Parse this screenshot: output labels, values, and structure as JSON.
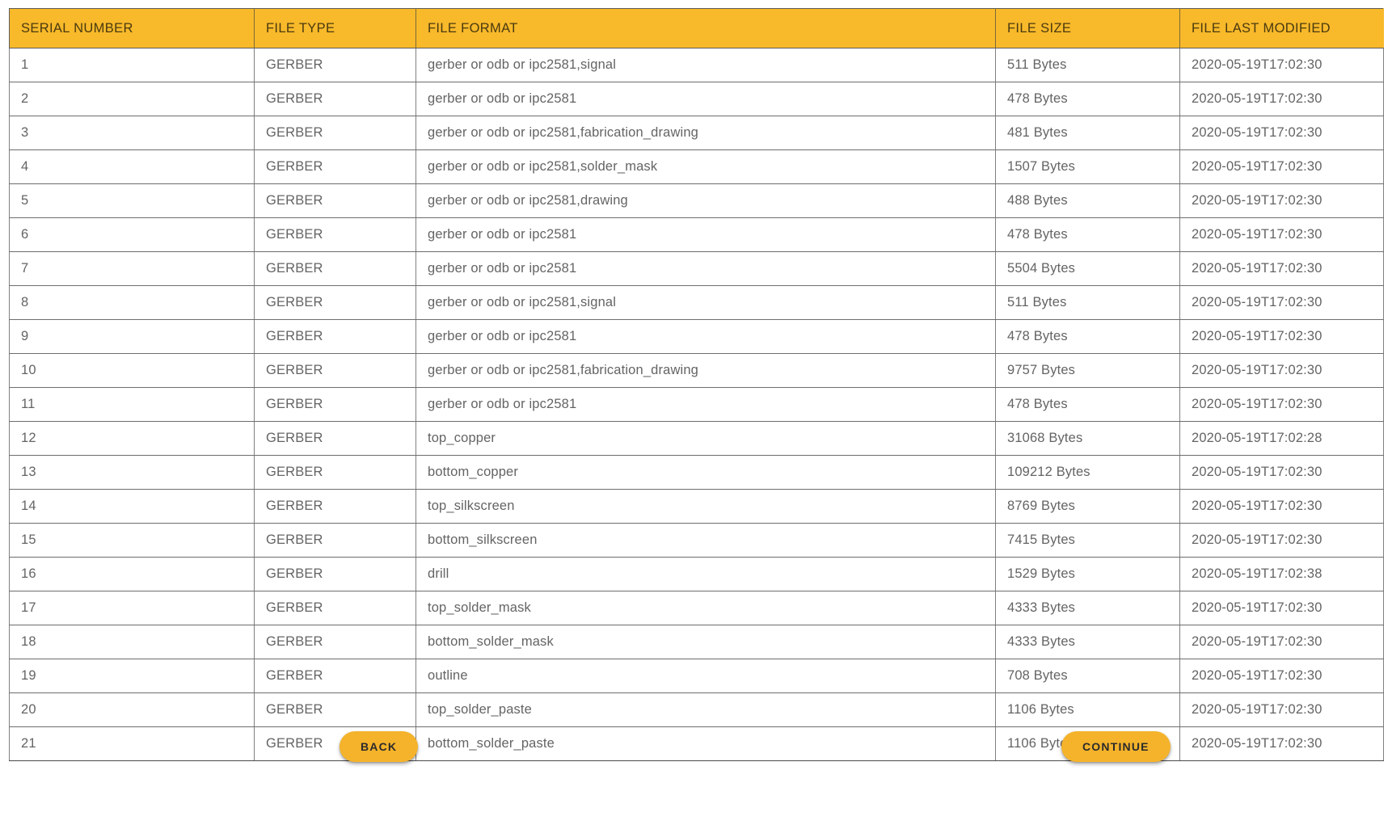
{
  "theme": {
    "header_background": "#f8b92a",
    "header_text": "#4a3a10",
    "button_background": "#f5b32b",
    "button_text": "#2b2b2b",
    "body_text": "#646464",
    "border": "#808080",
    "page_background": "#ffffff"
  },
  "table": {
    "columns": [
      {
        "key": "serial_number",
        "label": "SERIAL NUMBER"
      },
      {
        "key": "file_type",
        "label": "FILE TYPE"
      },
      {
        "key": "file_format",
        "label": "FILE FORMAT"
      },
      {
        "key": "file_size",
        "label": "FILE SIZE"
      },
      {
        "key": "file_last_modified",
        "label": "FILE LAST MODIFIED"
      }
    ],
    "rows": [
      {
        "serial_number": "1",
        "file_type": "GERBER",
        "file_format": "gerber or odb or ipc2581,signal",
        "file_size": "511 Bytes",
        "file_last_modified": "2020-05-19T17:02:30"
      },
      {
        "serial_number": "2",
        "file_type": "GERBER",
        "file_format": "gerber or odb or ipc2581",
        "file_size": "478 Bytes",
        "file_last_modified": "2020-05-19T17:02:30"
      },
      {
        "serial_number": "3",
        "file_type": "GERBER",
        "file_format": "gerber or odb or ipc2581,fabrication_drawing",
        "file_size": "481 Bytes",
        "file_last_modified": "2020-05-19T17:02:30"
      },
      {
        "serial_number": "4",
        "file_type": "GERBER",
        "file_format": "gerber or odb or ipc2581,solder_mask",
        "file_size": "1507 Bytes",
        "file_last_modified": "2020-05-19T17:02:30"
      },
      {
        "serial_number": "5",
        "file_type": "GERBER",
        "file_format": "gerber or odb or ipc2581,drawing",
        "file_size": "488 Bytes",
        "file_last_modified": "2020-05-19T17:02:30"
      },
      {
        "serial_number": "6",
        "file_type": "GERBER",
        "file_format": "gerber or odb or ipc2581",
        "file_size": "478 Bytes",
        "file_last_modified": "2020-05-19T17:02:30"
      },
      {
        "serial_number": "7",
        "file_type": "GERBER",
        "file_format": "gerber or odb or ipc2581",
        "file_size": "5504 Bytes",
        "file_last_modified": "2020-05-19T17:02:30"
      },
      {
        "serial_number": "8",
        "file_type": "GERBER",
        "file_format": "gerber or odb or ipc2581,signal",
        "file_size": "511 Bytes",
        "file_last_modified": "2020-05-19T17:02:30"
      },
      {
        "serial_number": "9",
        "file_type": "GERBER",
        "file_format": "gerber or odb or ipc2581",
        "file_size": "478 Bytes",
        "file_last_modified": "2020-05-19T17:02:30"
      },
      {
        "serial_number": "10",
        "file_type": "GERBER",
        "file_format": "gerber or odb or ipc2581,fabrication_drawing",
        "file_size": "9757 Bytes",
        "file_last_modified": "2020-05-19T17:02:30"
      },
      {
        "serial_number": "11",
        "file_type": "GERBER",
        "file_format": "gerber or odb or ipc2581",
        "file_size": "478 Bytes",
        "file_last_modified": "2020-05-19T17:02:30"
      },
      {
        "serial_number": "12",
        "file_type": "GERBER",
        "file_format": "top_copper",
        "file_size": "31068 Bytes",
        "file_last_modified": "2020-05-19T17:02:28"
      },
      {
        "serial_number": "13",
        "file_type": "GERBER",
        "file_format": "bottom_copper",
        "file_size": "109212 Bytes",
        "file_last_modified": "2020-05-19T17:02:30"
      },
      {
        "serial_number": "14",
        "file_type": "GERBER",
        "file_format": "top_silkscreen",
        "file_size": "8769 Bytes",
        "file_last_modified": "2020-05-19T17:02:30"
      },
      {
        "serial_number": "15",
        "file_type": "GERBER",
        "file_format": "bottom_silkscreen",
        "file_size": "7415 Bytes",
        "file_last_modified": "2020-05-19T17:02:30"
      },
      {
        "serial_number": "16",
        "file_type": "GERBER",
        "file_format": "drill",
        "file_size": "1529 Bytes",
        "file_last_modified": "2020-05-19T17:02:38"
      },
      {
        "serial_number": "17",
        "file_type": "GERBER",
        "file_format": "top_solder_mask",
        "file_size": "4333 Bytes",
        "file_last_modified": "2020-05-19T17:02:30"
      },
      {
        "serial_number": "18",
        "file_type": "GERBER",
        "file_format": "bottom_solder_mask",
        "file_size": "4333 Bytes",
        "file_last_modified": "2020-05-19T17:02:30"
      },
      {
        "serial_number": "19",
        "file_type": "GERBER",
        "file_format": "outline",
        "file_size": "708 Bytes",
        "file_last_modified": "2020-05-19T17:02:30"
      },
      {
        "serial_number": "20",
        "file_type": "GERBER",
        "file_format": "top_solder_paste",
        "file_size": "1106 Bytes",
        "file_last_modified": "2020-05-19T17:02:30"
      },
      {
        "serial_number": "21",
        "file_type": "GERBER",
        "file_format": "bottom_solder_paste",
        "file_size": "1106 Bytes",
        "file_last_modified": "2020-05-19T17:02:30"
      }
    ]
  },
  "actions": {
    "back_label": "BACK",
    "continue_label": "CONTINUE"
  }
}
